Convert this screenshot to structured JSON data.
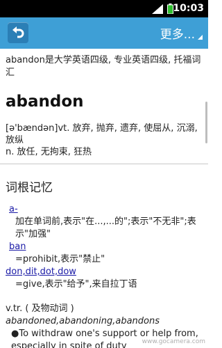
{
  "status_bar": {
    "time": "10:03"
  },
  "title_bar": {
    "more_label": "更多..."
  },
  "entry": {
    "exam_note": "abandon是大学英语四级, 专业英语四级, 托福词汇",
    "headword": "abandon",
    "definition_vt": "[ə'bændən]vt. 放弃, 抛弃, 遗弃, 使屈从, 沉溺, 放纵",
    "definition_n": "n. 放任, 无拘束, 狂热"
  },
  "roots": {
    "title": "词根记忆",
    "items": [
      {
        "root": "a-",
        "meaning": "加在单词前,表示\"在...,...的\";表示\"不无非\";表示\"加强\""
      },
      {
        "root": "ban",
        "meaning": "=prohibit,表示\"禁止\""
      },
      {
        "root": "don,dit,dot,dow",
        "meaning": "=give,表示\"给予\",来自拉丁语"
      }
    ]
  },
  "usage": {
    "pos": "v.tr. ( 及物动词 )",
    "forms": "abandoned,abandoning,abandons",
    "example": "●To withdraw one's support or help from, especially in spite of duty"
  },
  "watermark": "www.gocamera.com"
}
